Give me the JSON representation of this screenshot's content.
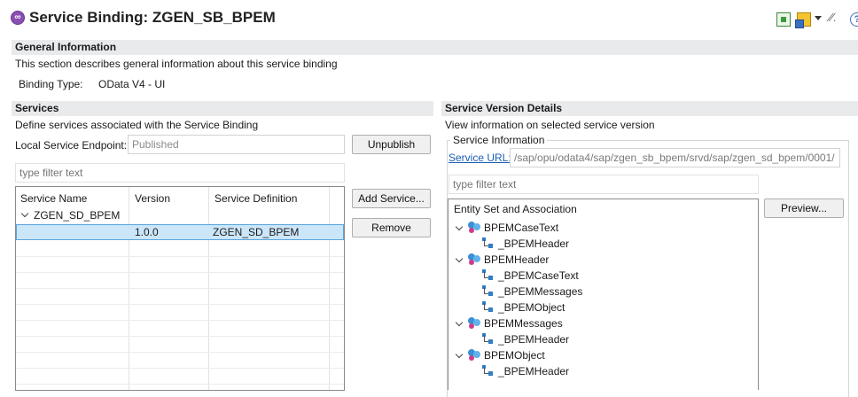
{
  "window": {
    "title": "Service Binding: ZGEN_SB_BPEM",
    "icons": [
      "service-binding-icon",
      "export-icon",
      "share-icon",
      "menu-chevron-icon",
      "wand-icon",
      "help-icon"
    ]
  },
  "general": {
    "header": "General Information",
    "description": "This section describes general information about this service binding",
    "binding_type_label": "Binding Type:",
    "binding_type_value": "OData V4 - UI"
  },
  "services": {
    "header": "Services",
    "description": "Define services associated with the Service Binding",
    "endpoint_label": "Local Service Endpoint:",
    "endpoint_value": "Published",
    "unpublish_label": "Unpublish",
    "filter_placeholder": "type filter text",
    "add_service_label": "Add Service...",
    "remove_label": "Remove",
    "table": {
      "columns": [
        "Service Name",
        "Version",
        "Service Definition"
      ],
      "group": "ZGEN_SD_BPEM",
      "rows": [
        {
          "service_name": "",
          "version": "1.0.0",
          "definition": "ZGEN_SD_BPEM"
        }
      ]
    }
  },
  "version_details": {
    "header": "Service Version Details",
    "description": "View information on selected service version",
    "info_group_label": "Service Information",
    "service_url_label": "Service URL:",
    "service_url_value": "/sap/opu/odata4/sap/zgen_sb_bpem/srvd/sap/zgen_sd_bpem/0001/",
    "filter_placeholder": "type filter text",
    "preview_label": "Preview...",
    "tree_header": "Entity Set and Association",
    "tree": [
      {
        "name": "BPEMCaseText",
        "children": [
          "_BPEMHeader"
        ]
      },
      {
        "name": "BPEMHeader",
        "children": [
          "_BPEMCaseText",
          "_BPEMMessages",
          "_BPEMObject"
        ]
      },
      {
        "name": "BPEMMessages",
        "children": [
          "_BPEMHeader"
        ]
      },
      {
        "name": "BPEMObject",
        "children": [
          "_BPEMHeader"
        ]
      }
    ]
  }
}
